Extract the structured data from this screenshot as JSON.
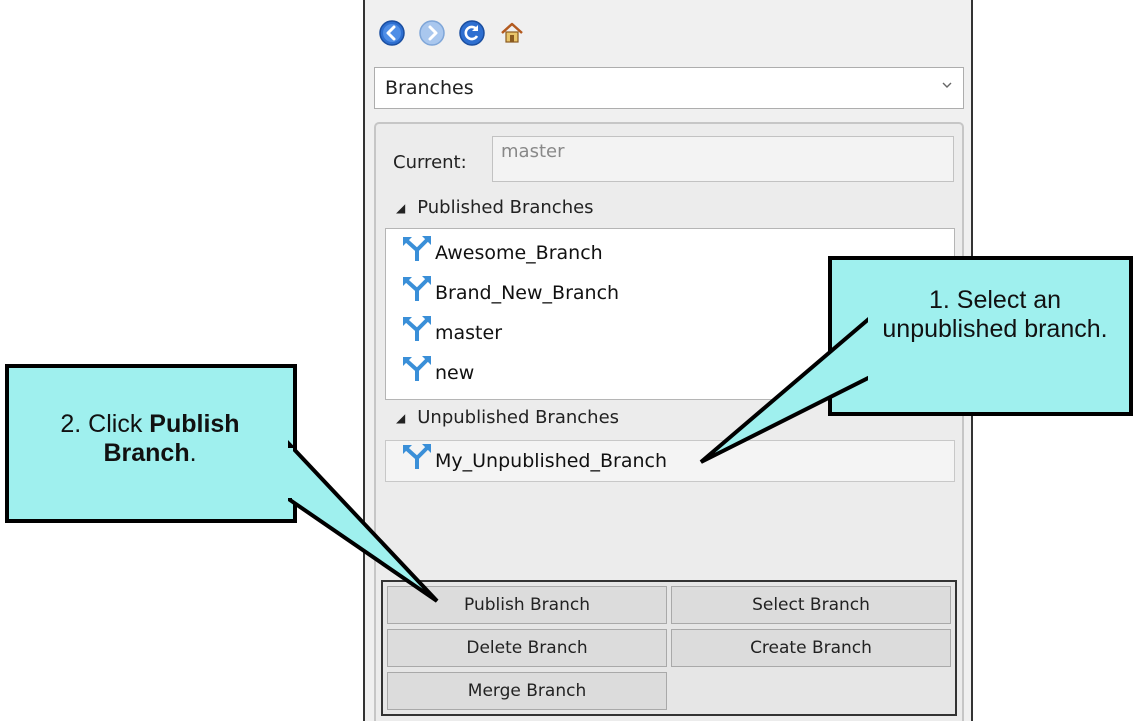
{
  "nav": {
    "buttons": [
      "back-icon",
      "forward-icon",
      "refresh-icon",
      "home-icon"
    ]
  },
  "dropdown": {
    "value": "Branches"
  },
  "current": {
    "label": "Current:",
    "value": "master"
  },
  "published": {
    "header": "Published Branches",
    "items": [
      "Awesome_Branch",
      "Brand_New_Branch",
      "master",
      "new"
    ]
  },
  "unpublished": {
    "header": "Unpublished Branches",
    "items": [
      "My_Unpublished_Branch"
    ]
  },
  "buttons": {
    "publish": "Publish Branch",
    "select": "Select Branch",
    "delete": "Delete Branch",
    "create": "Create Branch",
    "merge": "Merge Branch"
  },
  "callouts": {
    "right": "1. Select an unpublished branch.",
    "left_prefix": "2. Click ",
    "left_bold": "Publish Branch",
    "left_suffix": "."
  },
  "colors": {
    "callout_fill": "#9ff0ee",
    "callout_border": "#000000",
    "branch_icon": "#3a8fd8",
    "nav_blue": "#2e6fd0"
  }
}
